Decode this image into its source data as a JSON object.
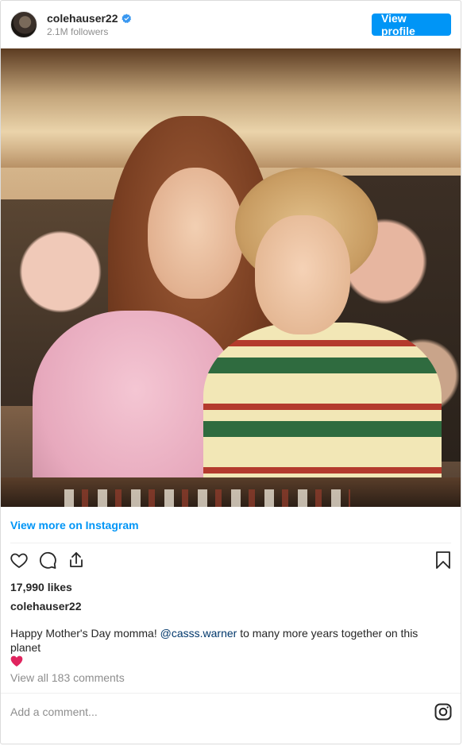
{
  "header": {
    "username": "colehauser22",
    "followers": "2.1M followers",
    "view_profile_label": "View profile"
  },
  "view_more_label": "View more on Instagram",
  "post": {
    "likes": "17,990 likes",
    "caption_username": "colehauser22",
    "caption_before": "Happy Mother's Day momma! ",
    "caption_mention": "@casss.warner",
    "caption_after": " to many more years together on this planet",
    "view_comments": "View all 183 comments"
  },
  "comment_box": {
    "placeholder": "Add a comment..."
  },
  "colors": {
    "accent": "#0095f6",
    "mention": "#00376b",
    "muted": "#8e8e8e",
    "heart": "#e0245e"
  },
  "icons": [
    "avatar",
    "verified-badge-icon",
    "heart-icon",
    "comment-icon",
    "share-icon",
    "bookmark-icon",
    "red-heart-emoji-icon",
    "instagram-logo-icon"
  ]
}
